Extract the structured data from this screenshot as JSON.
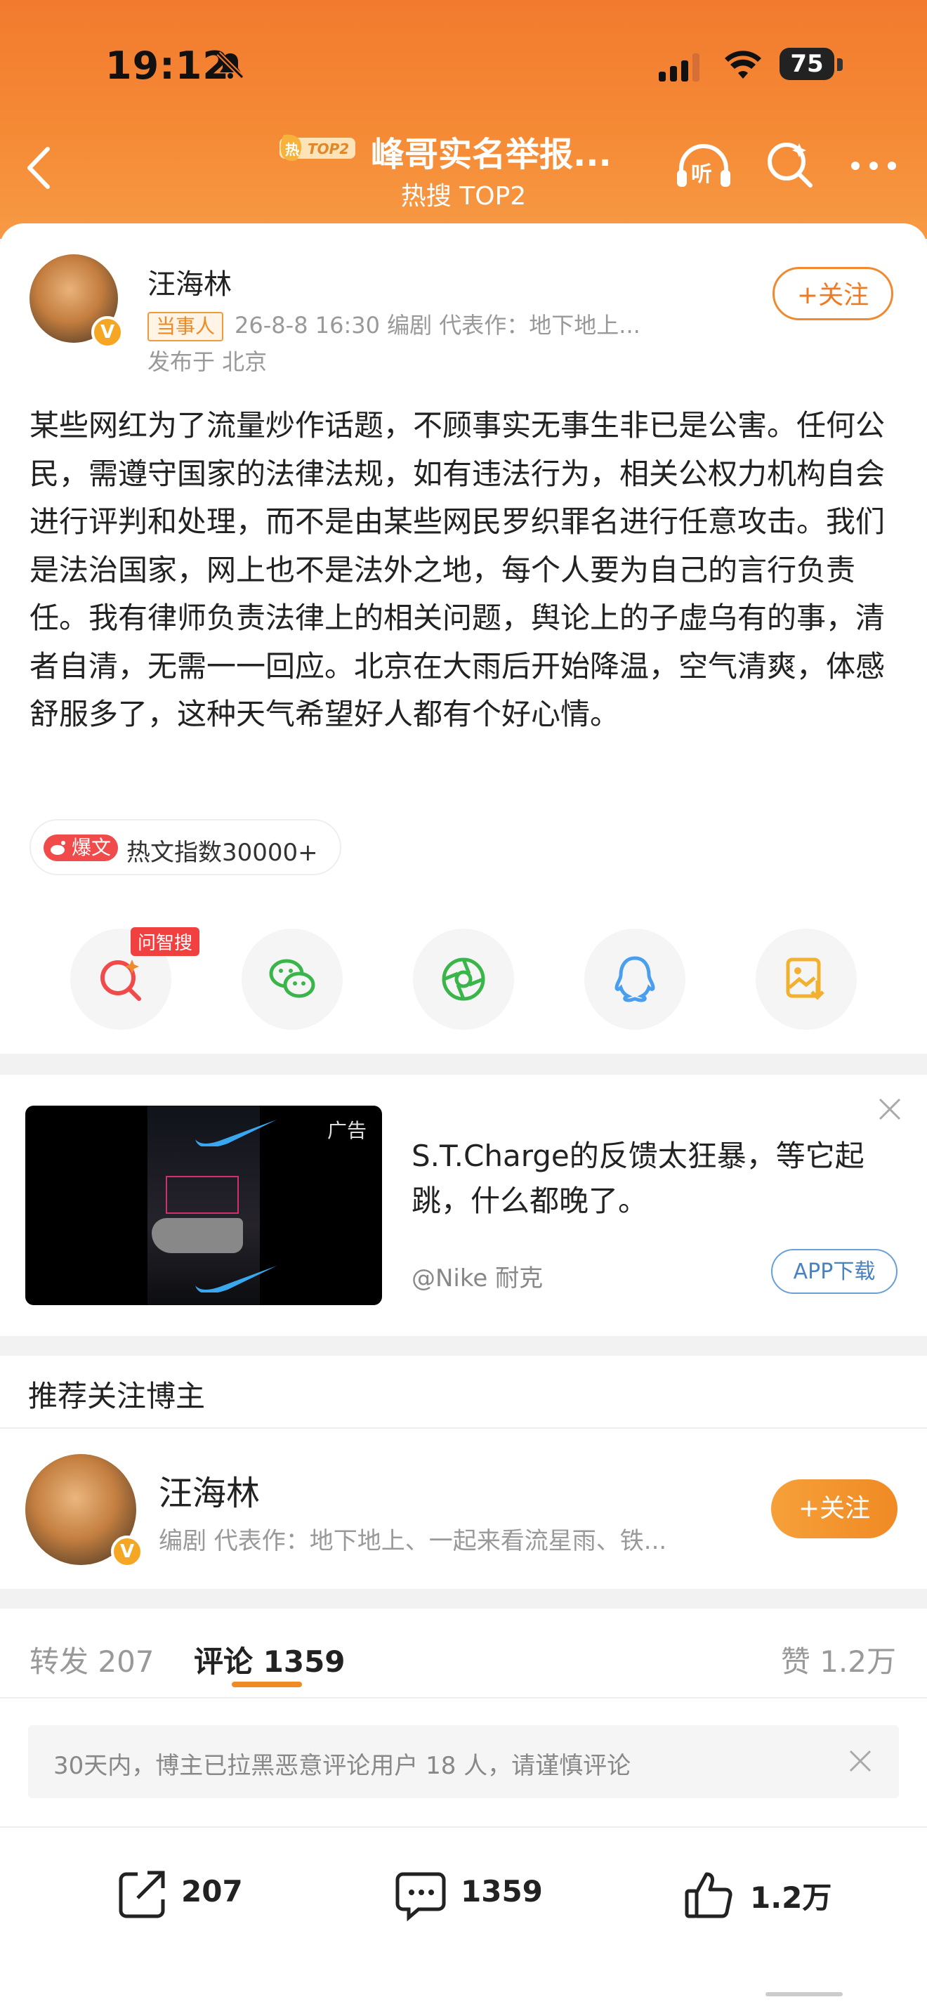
{
  "status_bar": {
    "time": "19:12",
    "battery": "75"
  },
  "nav": {
    "hot_badge": "热 TOP2",
    "title": "峰哥实名举报...",
    "subtitle": "热搜 TOP2",
    "listen_label": "听"
  },
  "post": {
    "author": "汪海林",
    "author_tag": "当事人",
    "meta": "26-8-8 16:30  编剧  代表作：地下地上...",
    "location": "发布于 北京",
    "follow_label": "+关注",
    "body": "某些网红为了流量炒作话题，不顾事实无事生非已是公害。任何公民，需遵守国家的法律法规，如有违法行为，相关公权力机构自会进行评判和处理，而不是由某些网民罗织罪名进行任意攻击。我们是法治国家，网上也不是法外之地，每个人要为自己的言行负责任。我有律师负责法律上的相关问题，舆论上的子虚乌有的事，清者自清，无需一一回应。北京在大雨后开始降温，空气清爽，体感舒服多了，这种天气希望好人都有个好心情。",
    "hot_tag": "爆文",
    "hot_index": "热文指数30000+",
    "wenzhisou": "问智搜"
  },
  "share_icons": [
    "zhisou-search-icon",
    "wechat-icon",
    "moments-icon",
    "qq-icon",
    "save-image-icon"
  ],
  "ad": {
    "label": "广告",
    "title": "S.T.Charge的反馈太狂暴，等它起跳，什么都晚了。",
    "source": "@Nike 耐克",
    "button": "APP下载"
  },
  "recommend": {
    "header": "推荐关注博主",
    "name": "汪海林",
    "desc": "编剧  代表作：地下地上、一起来看流星雨、铁...",
    "follow_label": "+关注"
  },
  "tabs": {
    "repost": "转发 207",
    "comment": "评论 1359",
    "like": "赞 1.2万"
  },
  "notice": "30天内，博主已拉黑恶意评论用户 18 人，请谨慎评论",
  "actions": {
    "repost": "207",
    "comment": "1359",
    "like": "1.2万"
  },
  "colors": {
    "accent": "#f08a24",
    "header": "#f58a35"
  }
}
